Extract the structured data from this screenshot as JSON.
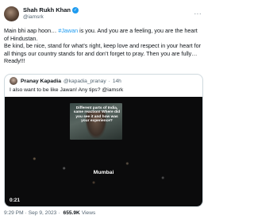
{
  "author": {
    "display_name": "Shah Rukh Khan",
    "handle": "@iamsrk",
    "verified_mark": "✓",
    "more_label": "···"
  },
  "tweet": {
    "text_before_hashtag": "Main bhi aap hoon… ",
    "hashtag": "#Jawan",
    "text_after_hashtag": " is you. And you are a feeling, you are the heart of Hindustan.",
    "paragraph2": "Be kind, be nice, stand for what’s right, keep love and respect in your heart for all things our country stands for and don’t forget to pray. Then you are fully…Ready!!!"
  },
  "quoted": {
    "display_name": "Pranay Kapadia",
    "handle": "@kapadia_pranay",
    "separator": "·",
    "age": "14h",
    "text": "I also want to be like Jawan! Any tips? @iamsrk",
    "video": {
      "overlay_text": "Different parts of India, same reaction! Where did you see it and how was your experience?",
      "location_label": "Mumbai",
      "duration": "0:21"
    }
  },
  "footer": {
    "time": "9:29 PM",
    "separator": "·",
    "date": "Sep 9, 2023",
    "views_count": "655.9K",
    "views_label": "Views"
  },
  "colors": {
    "link": "#1d9bf0",
    "secondary_text": "#536471",
    "border": "#cfd9de"
  }
}
